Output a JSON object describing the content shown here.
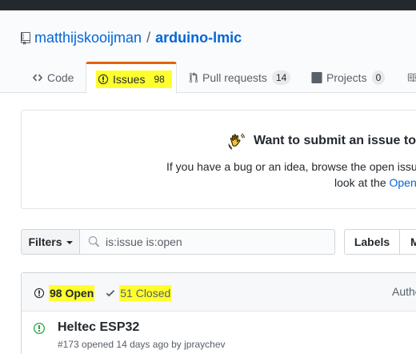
{
  "repo": {
    "owner": "matthijskooijman",
    "separator": "/",
    "name": "arduino-lmic"
  },
  "tabs": [
    {
      "label": "Code",
      "icon": "code-icon"
    },
    {
      "label": "Issues",
      "count": "98",
      "icon": "issue-opened-icon",
      "selected": true
    },
    {
      "label": "Pull requests",
      "count": "14",
      "icon": "git-pull-request-icon"
    },
    {
      "label": "Projects",
      "count": "0",
      "icon": "project-icon"
    }
  ],
  "banner": {
    "title": "Want to submit an issue to m",
    "line1": "If you have a bug or an idea, browse the open issu",
    "line2_prefix": "look at the ",
    "line2_link": "Open"
  },
  "toolbar": {
    "filters_label": "Filters",
    "search_value": "is:issue is:open",
    "labels_label": "Labels",
    "milestones_label": "M"
  },
  "list": {
    "open_label": "98 Open",
    "closed_label": "51 Closed",
    "author_label": "Autho"
  },
  "issues": [
    {
      "title": "Heltec ESP32",
      "meta": "#173 opened 14 days ago by jpraychev"
    }
  ],
  "colors": {
    "highlight": "#ffff2e",
    "link": "#0366d6",
    "tab_accent": "#e36209",
    "open_green": "#28a745"
  }
}
